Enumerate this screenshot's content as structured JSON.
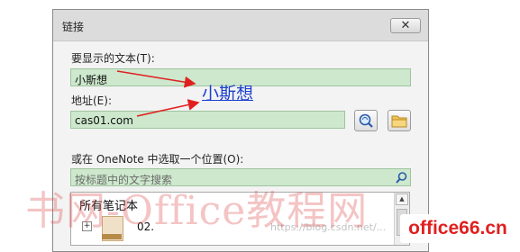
{
  "dialog": {
    "title": "链接",
    "close_glyph": "✕",
    "text_label": "要显示的文本(T):",
    "text_value": "小斯想",
    "address_label": "地址(E):",
    "address_value": "cas01.com",
    "onenote_label": "或在 OneNote 中选取一个位置(O):",
    "search_placeholder": "按标题中的文字搜索",
    "tree": {
      "header": "所有笔记本",
      "expander": "+",
      "items": [
        {
          "label": "02."
        }
      ]
    }
  },
  "annotation": {
    "link_text": "小斯想"
  },
  "overlay": {
    "watermark": "书网-Office教程网",
    "watermark_small": "https://blog.csdn.net/...",
    "site_badge": "office66.cn"
  },
  "colors": {
    "field_bg": "#cde8cd",
    "arrow": "#e02020",
    "link": "#1a3fd0"
  },
  "icons": [
    "close-icon",
    "browse-web-icon",
    "browse-file-icon",
    "search-icon",
    "notebook-icon",
    "scroll-up-icon"
  ]
}
